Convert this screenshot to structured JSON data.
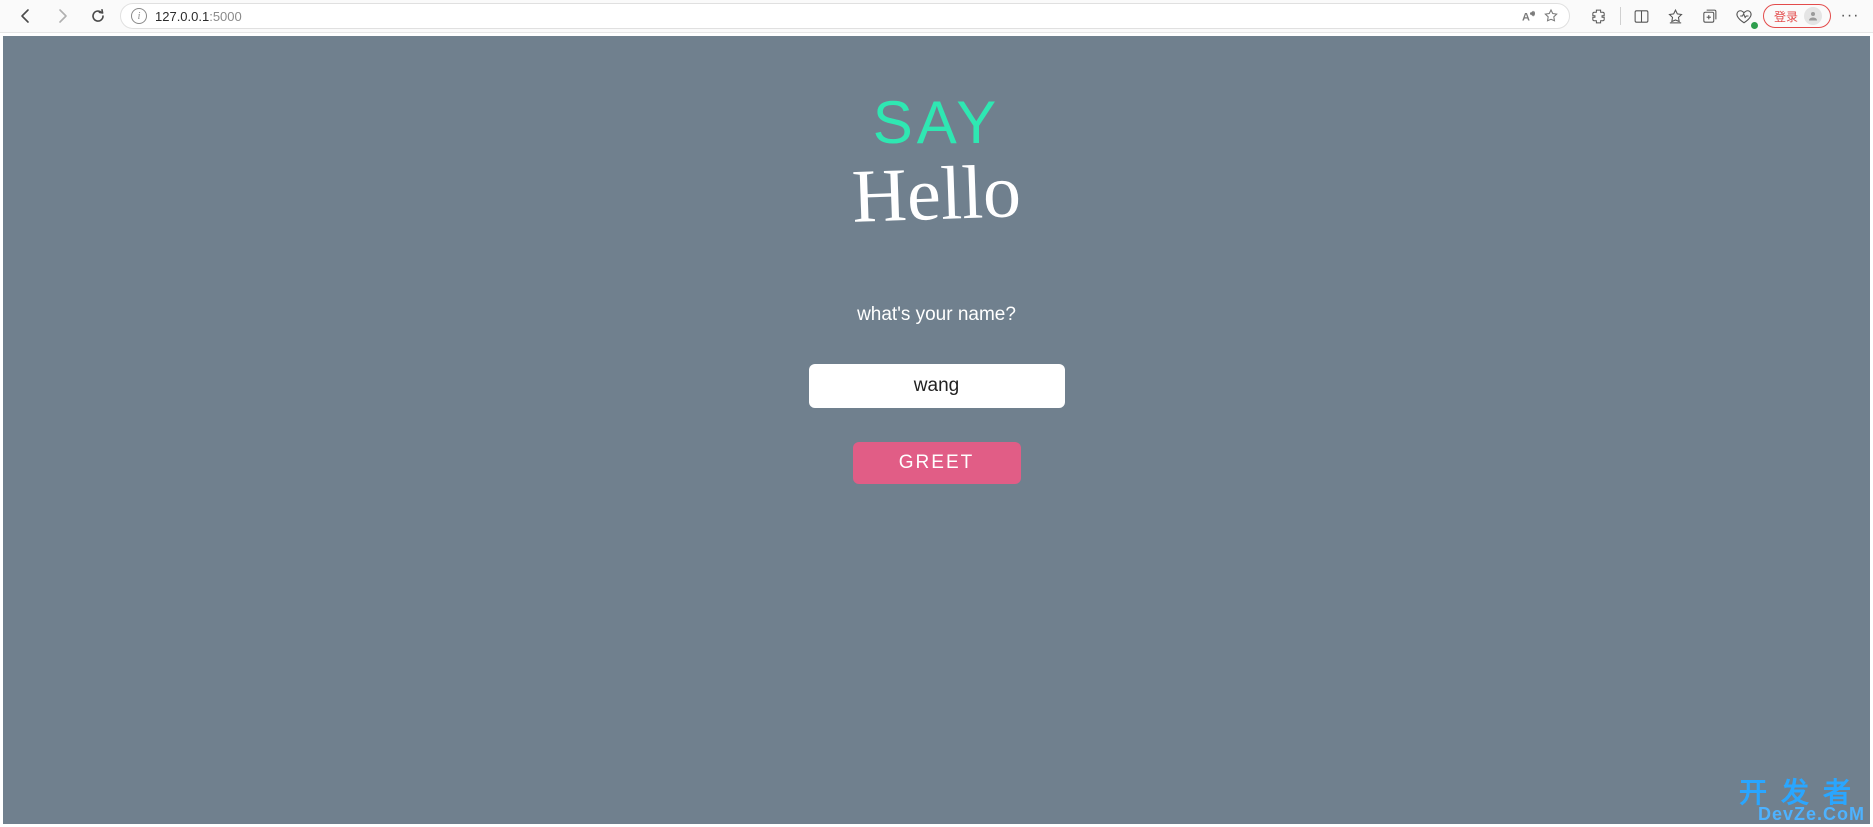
{
  "browser": {
    "url_host": "127.0.0.1",
    "url_port": ":5000",
    "login_label": "登录"
  },
  "page": {
    "title_top": "SAY",
    "title_bottom": "Hello",
    "prompt": "what's your name?",
    "name_value": "wang",
    "greet_label": "GREET"
  },
  "watermark": {
    "line1": "开发者",
    "line2": "DevZe.CoM"
  }
}
